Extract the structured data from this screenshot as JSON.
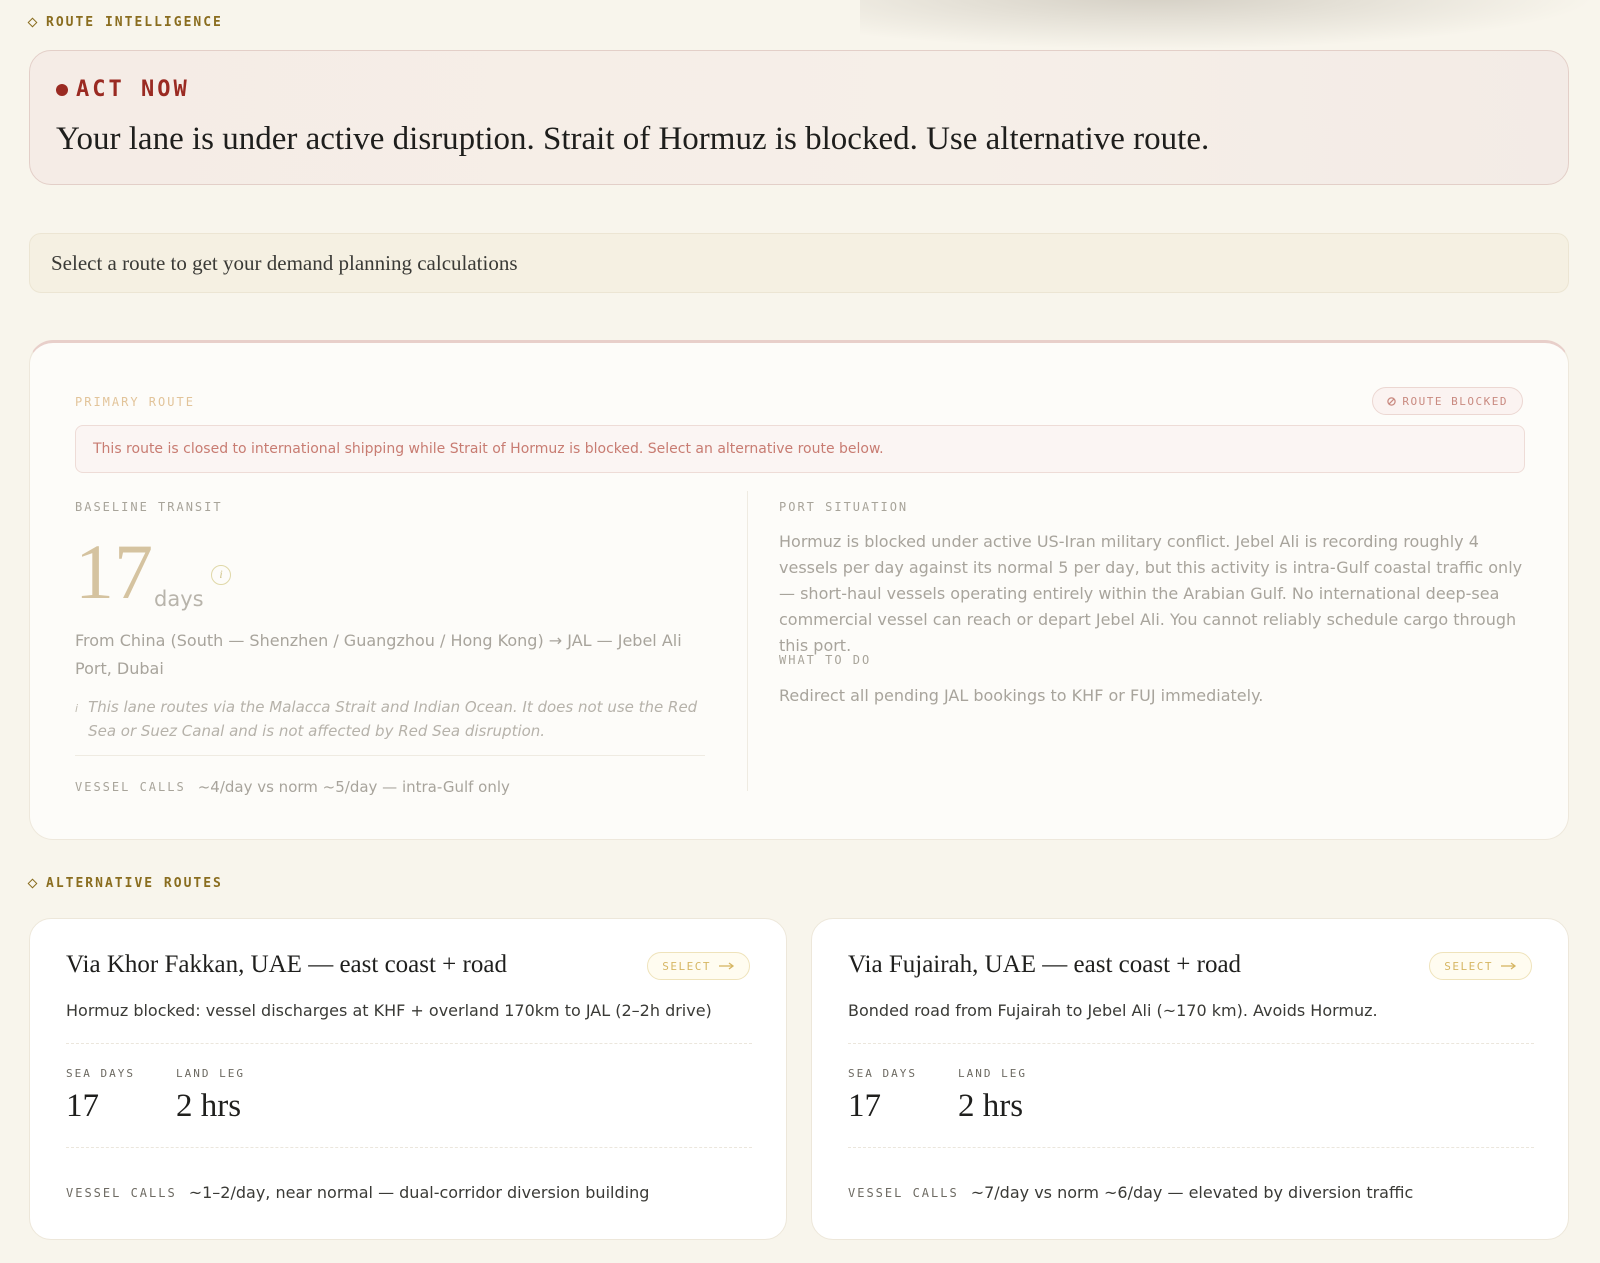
{
  "route_intelligence": {
    "label": "ROUTE INTELLIGENCE"
  },
  "alert": {
    "heading": "ACT NOW",
    "message": "Your lane is under active disruption. Strait of Hormuz is blocked. Use alternative route."
  },
  "select_prompt": "Select a route to get your demand planning calculations",
  "primary_route": {
    "label": "PRIMARY ROUTE",
    "status_badge": "ROUTE BLOCKED",
    "closed_note": "This route is closed to international shipping while Strait of Hormuz is blocked. Select an alternative route below.",
    "baseline_label": "BASELINE TRANSIT",
    "transit_days": "17",
    "transit_unit": "days",
    "info_glyph": "i",
    "from_text": "From China (South — Shenzhen / Guangzhou / Hong Kong) → JAL — Jebel Ali Port, Dubai",
    "lane_note": "This lane routes via the Malacca Strait and Indian Ocean. It does not use the Red Sea or Suez Canal and is not affected by Red Sea disruption.",
    "vessel_calls_label": "VESSEL CALLS",
    "vessel_calls_value": "~4/day vs norm ~5/day — intra-Gulf only",
    "port_situation_label": "PORT SITUATION",
    "port_situation_text": "Hormuz is blocked under active US-Iran military conflict. Jebel Ali is recording roughly 4 vessels per day against its normal 5 per day, but this activity is intra-Gulf coastal traffic only — short-haul vessels operating entirely within the Arabian Gulf. No international deep-sea commercial vessel can reach or depart Jebel Ali. You cannot reliably schedule cargo through this port.",
    "what_to_do_label": "WHAT TO DO",
    "what_to_do_text": "Redirect all pending JAL bookings to KHF or FUJ immediately."
  },
  "alternative_routes": {
    "label": "ALTERNATIVE ROUTES",
    "routes": [
      {
        "title": "Via Khor Fakkan, UAE — east coast + road",
        "select_label": "SELECT",
        "description": "Hormuz blocked: vessel discharges at KHF + overland 170km to JAL (2–2h drive)",
        "sea_days_label": "SEA DAYS",
        "sea_days": "17",
        "land_leg_label": "LAND LEG",
        "land_leg": "2 hrs",
        "vessel_calls_label": "VESSEL CALLS",
        "vessel_calls_value": "~1–2/day, near normal — dual-corridor diversion building"
      },
      {
        "title": "Via Fujairah, UAE — east coast + road",
        "select_label": "SELECT",
        "description": "Bonded road from Fujairah to Jebel Ali (~170 km). Avoids Hormuz.",
        "sea_days_label": "SEA DAYS",
        "sea_days": "17",
        "land_leg_label": "LAND LEG",
        "land_leg": "2 hrs",
        "vessel_calls_label": "VESSEL CALLS",
        "vessel_calls_value": "~7/day vs norm ~6/day — elevated by diversion traffic"
      }
    ]
  },
  "colors": {
    "accent_gold": "#8a6d1f",
    "alert_red": "#9a2a22",
    "background": "#f8f5ec"
  },
  "icons": [
    "diamond-icon",
    "alert-dot-icon",
    "blocked-circle-icon",
    "info-icon",
    "arrow-right-icon"
  ]
}
